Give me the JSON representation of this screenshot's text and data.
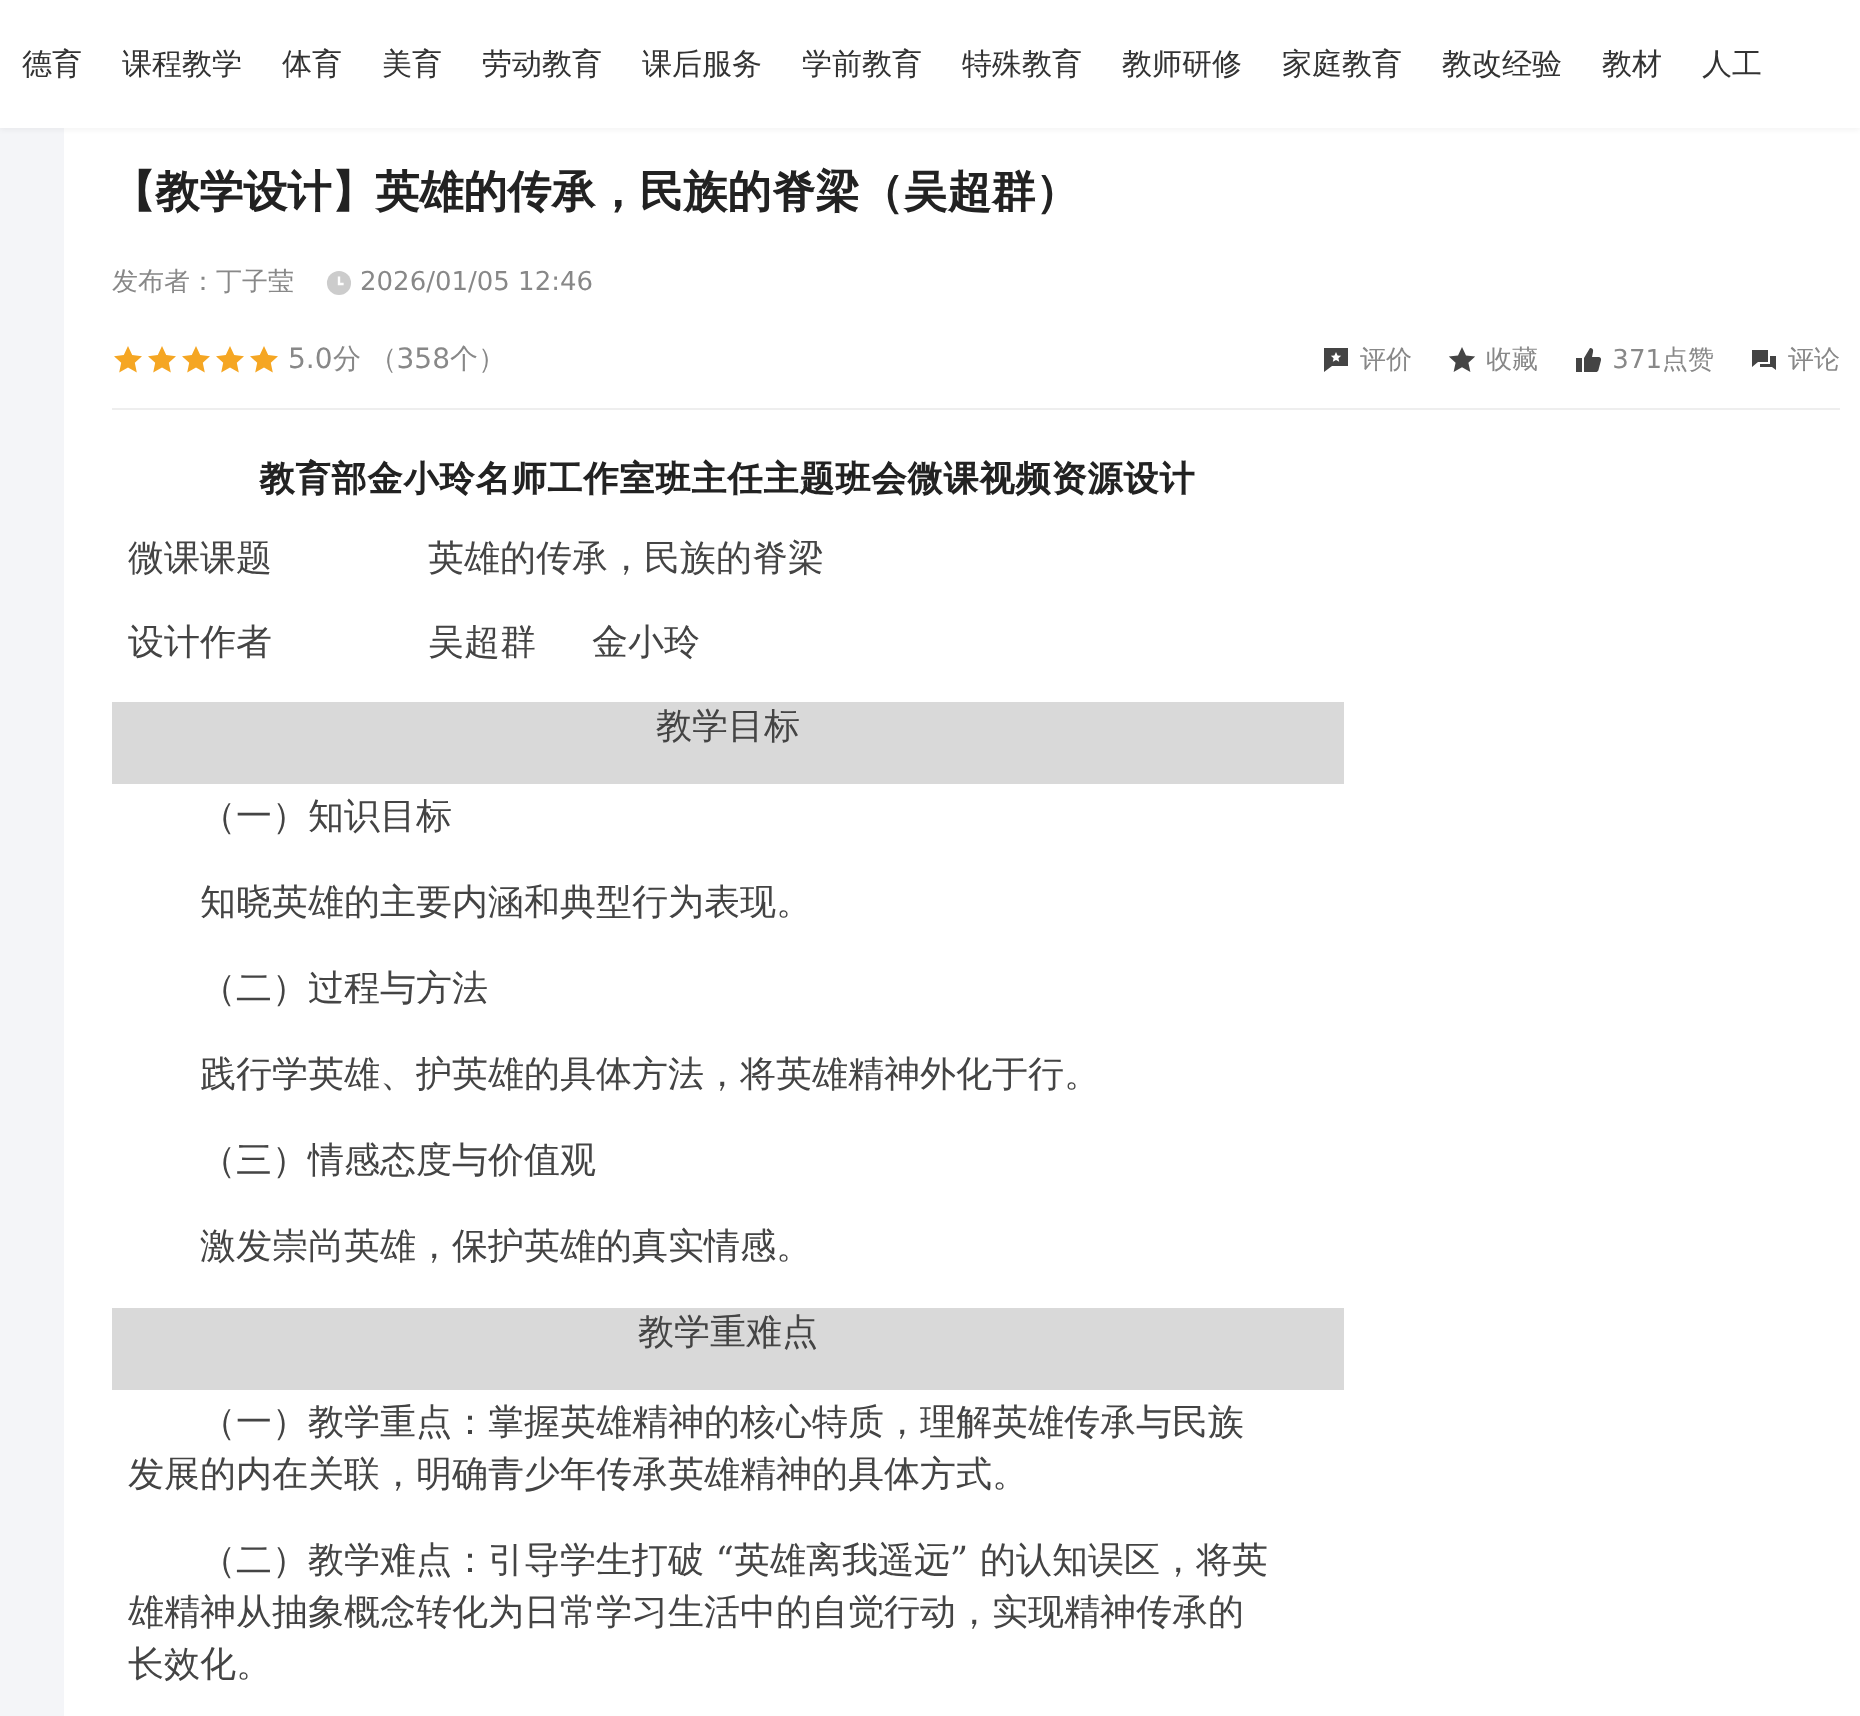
{
  "nav": [
    {
      "label": "德育"
    },
    {
      "label": "课程教学"
    },
    {
      "label": "体育"
    },
    {
      "label": "美育"
    },
    {
      "label": "劳动教育"
    },
    {
      "label": "课后服务"
    },
    {
      "label": "学前教育"
    },
    {
      "label": "特殊教育"
    },
    {
      "label": "教师研修"
    },
    {
      "label": "家庭教育"
    },
    {
      "label": "教改经验"
    },
    {
      "label": "教材"
    },
    {
      "label": "人工"
    }
  ],
  "article": {
    "title": "【教学设计】英雄的传承，民族的脊梁（吴超群）",
    "publisher": "发布者：丁子莹",
    "time": "2026/01/05 12:46",
    "stars": 5,
    "rating": "5.0分",
    "count": "（358个）",
    "actions": [
      {
        "kind": "review",
        "label": "评价"
      },
      {
        "kind": "favorite",
        "label": "收藏"
      },
      {
        "kind": "like",
        "label": "371点赞"
      },
      {
        "kind": "comment",
        "label": "评论"
      }
    ]
  },
  "document": {
    "heading": "教育部金小玲名师工作室班主任主题班会微课视频资源设计",
    "blocks": [
      {
        "kind": "field",
        "label": "微课课题",
        "values": [
          "英雄的传承，民族的脊梁"
        ]
      },
      {
        "kind": "field",
        "label": "设计作者",
        "values": [
          "吴超群",
          "金小玲"
        ]
      },
      {
        "kind": "section",
        "text": "教学目标"
      },
      {
        "kind": "paragraph",
        "text": "（一）知识目标"
      },
      {
        "kind": "paragraph",
        "text": "知晓英雄的主要内涵和典型行为表现。"
      },
      {
        "kind": "paragraph",
        "text": "（二）过程与方法"
      },
      {
        "kind": "paragraph",
        "text": "践行学英雄、护英雄的具体方法，将英雄精神外化于行。"
      },
      {
        "kind": "paragraph",
        "text": "（三）情感态度与价值观"
      },
      {
        "kind": "paragraph",
        "text": "激发崇尚英雄，保护英雄的真实情感。"
      },
      {
        "kind": "section",
        "text": "教学重难点"
      },
      {
        "kind": "paragraph",
        "text": "（一）教学重点：掌握英雄精神的核心特质，理解英雄传承与民族发展的内在关联，明确青少年传承英雄精神的具体方式。"
      },
      {
        "kind": "paragraph",
        "text": "（二）教学难点：引导学生打破 “英雄离我遥远” 的认知误区，将英雄精神从抽象概念转化为日常学习生活中的自觉行动，实现精神传承的长效化。"
      }
    ]
  }
}
